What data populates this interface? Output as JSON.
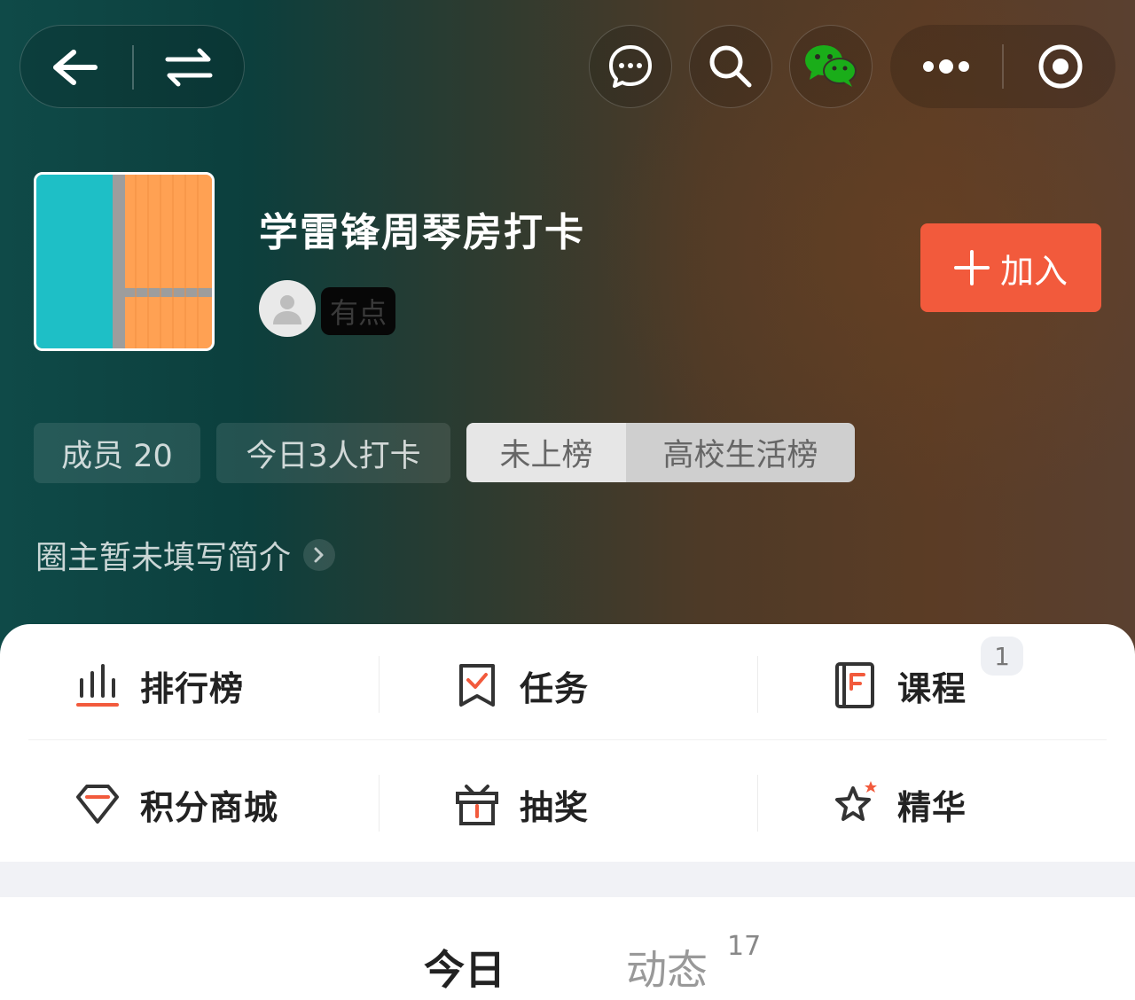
{
  "header": {
    "title": "学雷锋周琴房打卡",
    "owner_name": "有点",
    "join_label": "加入"
  },
  "top_bar": {
    "back_icon": "arrow-left-icon",
    "switch_icon": "swap-arrows-icon",
    "chat_icon": "chat-bubble-icon",
    "search_icon": "search-icon",
    "wechat_icon": "wechat-icon",
    "more_icon": "more-dots-icon",
    "close_icon": "target-circle-icon"
  },
  "tags": {
    "members": "成员 20",
    "today_checkin": "今日3人打卡",
    "rank_status": "未上榜",
    "rank_board": "高校生活榜"
  },
  "intro": "圈主暂未填写简介",
  "menu": [
    {
      "label": "排行榜",
      "icon": "bar-chart-icon"
    },
    {
      "label": "任务",
      "icon": "task-bookmark-icon"
    },
    {
      "label": "课程",
      "icon": "notebook-icon",
      "badge": "1"
    },
    {
      "label": "积分商城",
      "icon": "diamond-icon"
    },
    {
      "label": "抽奖",
      "icon": "gift-box-icon"
    },
    {
      "label": "精华",
      "icon": "star-icon"
    }
  ],
  "tabs": {
    "today": "今日",
    "feed": "动态",
    "feed_count": "17"
  },
  "colors": {
    "accent": "#f25a3c",
    "wechat_green": "#1aad19"
  }
}
